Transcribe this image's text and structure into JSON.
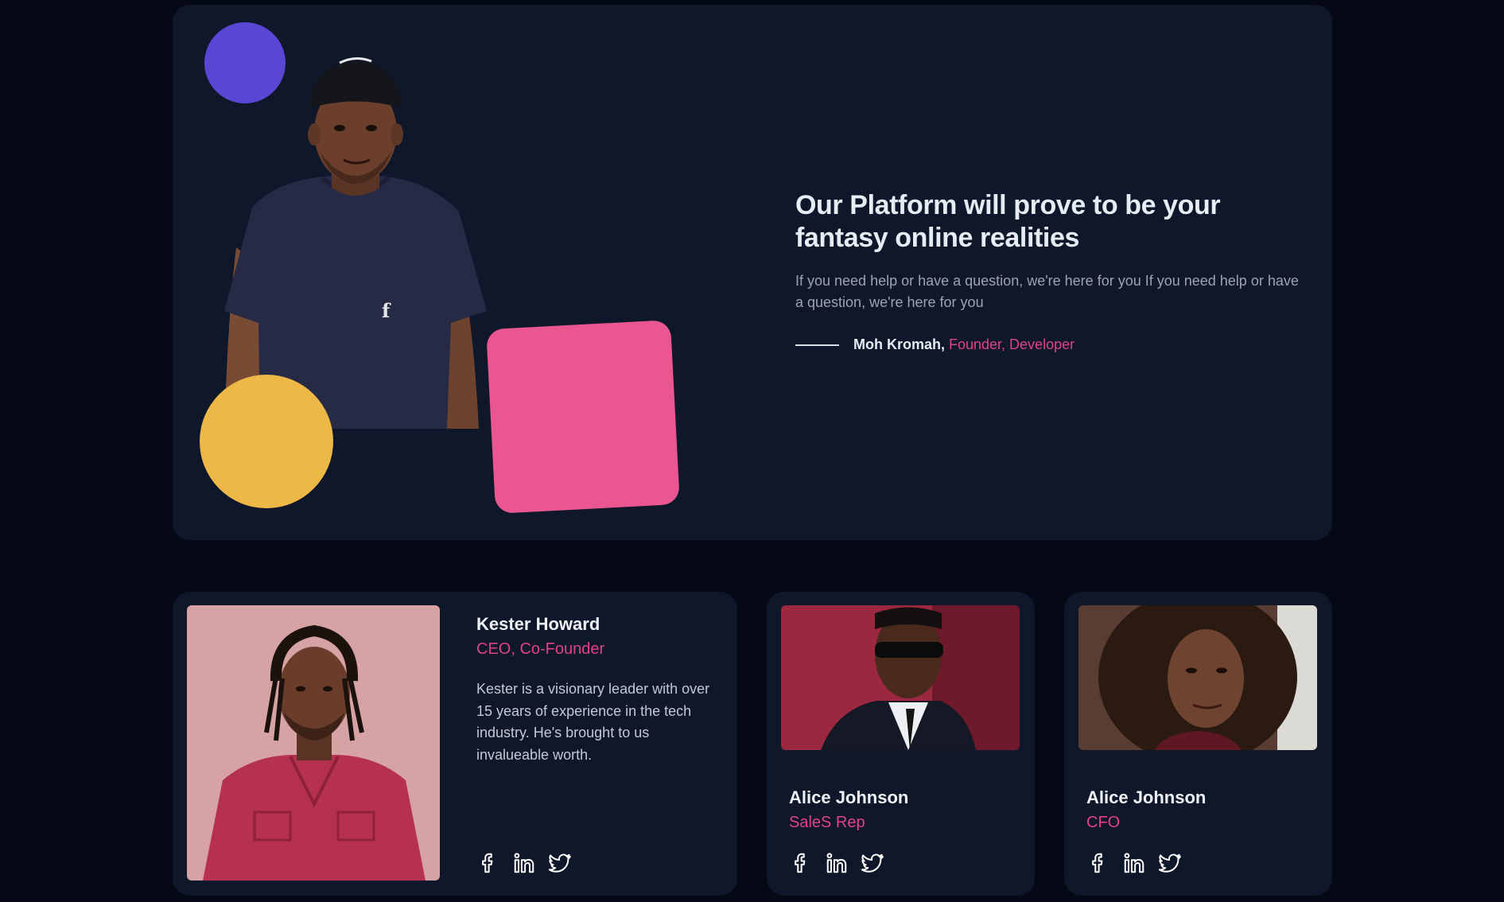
{
  "hero": {
    "title": "Our Platform will prove to be your fantasy online realities",
    "body": "If you need help or have a question, we're here for you If you need help or have a question, we're here for you",
    "author_name": "Moh Kromah,",
    "author_role": "Founder, Developer",
    "shape_colors": {
      "purple": "#5a46d4",
      "yellow": "#edb846",
      "pink": "#ea5690"
    }
  },
  "team": [
    {
      "name": "Kester Howard",
      "role": "CEO, Co-Founder",
      "bio": "Kester is a visionary leader with over 15 years of experience in the tech industry. He's brought to us invalueable worth.",
      "socials": [
        "facebook-icon",
        "linkedin-icon",
        "twitter-icon"
      ]
    },
    {
      "name": "Alice Johnson",
      "role": "SaleS Rep",
      "socials": [
        "facebook-icon",
        "linkedin-icon",
        "twitter-icon"
      ]
    },
    {
      "name": "Alice Johnson",
      "role": "CFO",
      "socials": [
        "facebook-icon",
        "linkedin-icon",
        "twitter-icon"
      ]
    }
  ],
  "colors": {
    "page_bg": "#050915",
    "card_bg": "#0f172a",
    "accent": "#e0428a"
  }
}
